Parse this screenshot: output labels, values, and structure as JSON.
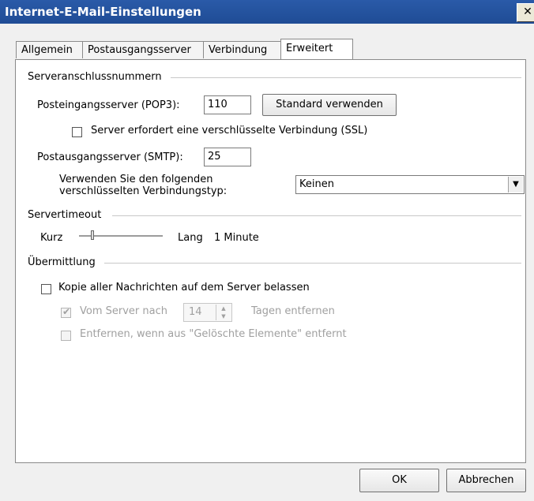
{
  "window": {
    "title": "Internet-E-Mail-Einstellungen",
    "close_glyph": "✕"
  },
  "tabs": [
    {
      "label": "Allgemein",
      "active": false
    },
    {
      "label": "Postausgangsserver",
      "active": false
    },
    {
      "label": "Verbindung",
      "active": false
    },
    {
      "label": "Erweitert",
      "active": true
    }
  ],
  "server_ports": {
    "group_title": "Serveranschlussnummern",
    "pop3_label": "Posteingangsserver (POP3):",
    "pop3_value": "110",
    "default_button": "Standard verwenden",
    "ssl_label": "Server erfordert eine verschlüsselte Verbindung (SSL)",
    "ssl_checked": false,
    "smtp_label": "Postausgangsserver (SMTP):",
    "smtp_value": "25",
    "encryption_label_line1": "Verwenden Sie den folgenden",
    "encryption_label_line2": "verschlüsselten Verbindungstyp:",
    "encryption_value": "Keinen"
  },
  "timeout": {
    "group_title": "Servertimeout",
    "short_label": "Kurz",
    "long_label": "Lang",
    "value_label": "1 Minute",
    "level_fraction": 0.15
  },
  "delivery": {
    "group_title": "Übermittlung",
    "keep_copy_label": "Kopie aller Nachrichten auf dem Server belassen",
    "keep_copy_checked": false,
    "remove_after_prefix": "Vom Server nach",
    "remove_after_days": "14",
    "remove_after_suffix": "Tagen entfernen",
    "remove_after_checked": true,
    "remove_deleted_label": "Entfernen, wenn aus \"Gelöschte Elemente\" entfernt",
    "remove_deleted_checked": false
  },
  "footer": {
    "ok_label": "OK",
    "cancel_label": "Abbrechen"
  },
  "colors": {
    "title_bar": "#1f4c95",
    "window_bg": "#f0f0f0",
    "panel_bg": "#ffffff",
    "disabled_text": "#a0a0a0"
  }
}
